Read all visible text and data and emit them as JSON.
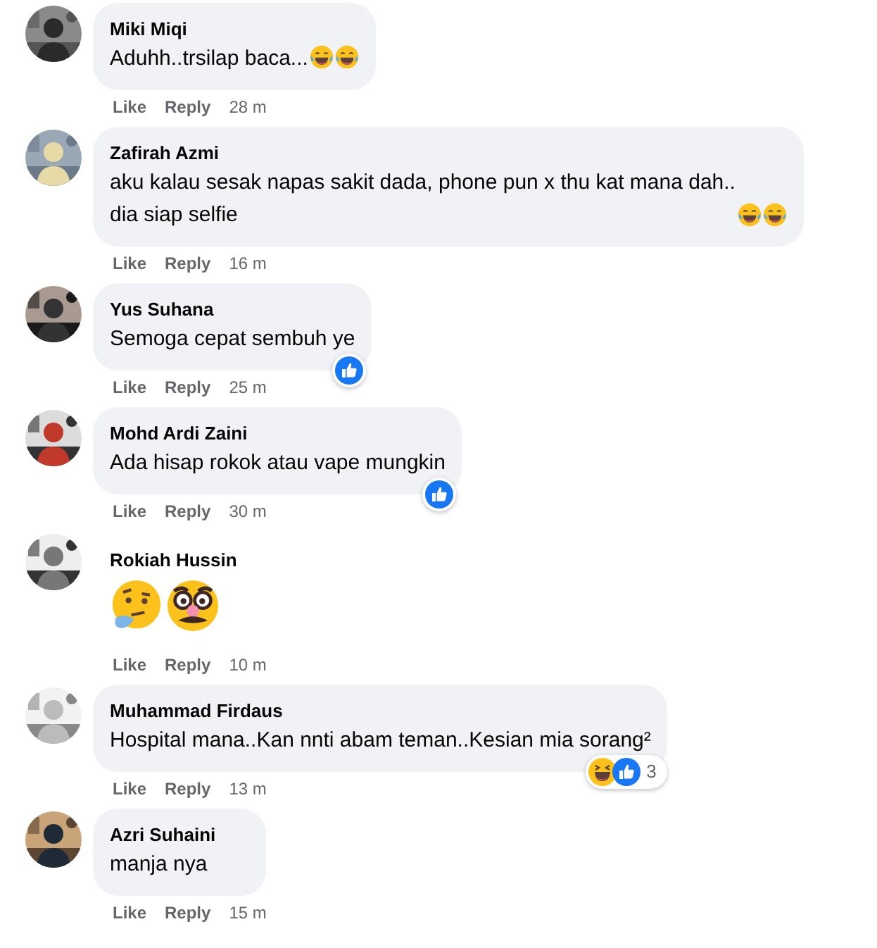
{
  "comments": [
    {
      "author": "Miki Miqi",
      "text": "Aduhh..trsilap baca...",
      "emojis": [
        {
          "kind": "tears-of-joy"
        },
        {
          "kind": "tears-of-joy"
        }
      ],
      "actions": [
        "Like",
        "Reply"
      ],
      "time": "28 m"
    },
    {
      "author": "Zafirah Azmi",
      "text": "aku kalau sesak napas sakit dada, phone pun x thu kat mana dah.. dia siap selfie",
      "emojis": [
        {
          "kind": "tears-of-joy"
        },
        {
          "kind": "tears-of-joy"
        }
      ],
      "actions": [
        "Like",
        "Reply"
      ],
      "time": "16 m"
    },
    {
      "author": "Yus Suhana",
      "text": "Semoga cepat sembuh ye",
      "actions": [
        "Like",
        "Reply"
      ],
      "time": "25 m",
      "reactions": [
        {
          "kind": "like"
        }
      ]
    },
    {
      "author": "Mohd Ardi Zaini",
      "text": "Ada hisap rokok atau vape mungkin",
      "actions": [
        "Like",
        "Reply"
      ],
      "time": "30 m",
      "reactions": [
        {
          "kind": "like"
        }
      ]
    },
    {
      "author": "Rokiah Hussin",
      "emojis": [
        {
          "kind": "thinking"
        },
        {
          "kind": "disguise"
        }
      ],
      "actions": [
        "Like",
        "Reply"
      ],
      "time": "10 m"
    },
    {
      "author": "Muhammad Firdaus",
      "text": "Hospital mana..Kan nnti abam teman..Kesian mia sorang²",
      "actions": [
        "Like",
        "Reply"
      ],
      "time": "13 m",
      "reactions": [
        {
          "kind": "haha"
        },
        {
          "kind": "like"
        }
      ],
      "reaction_count": "3"
    },
    {
      "author": "Azri Suhaini",
      "text": "manja nya",
      "actions": [
        "Like",
        "Reply"
      ],
      "time": "15 m"
    }
  ]
}
